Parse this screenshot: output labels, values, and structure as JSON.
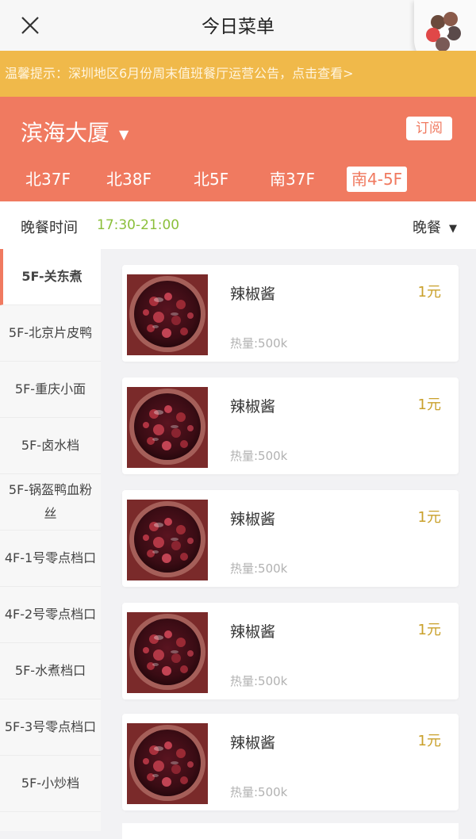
{
  "header": {
    "title": "今日菜单"
  },
  "notice": {
    "text": "温馨提示：深圳地区6月份周末值班餐厅运营公告，点击查看>"
  },
  "building": {
    "name": "滨海大厦",
    "subscribe_label": "订阅"
  },
  "floor_tabs": [
    {
      "label": "北37F"
    },
    {
      "label": "北38F"
    },
    {
      "label": "北5F"
    },
    {
      "label": "南37F"
    },
    {
      "label": "南4-5F",
      "active": true
    }
  ],
  "meal": {
    "label": "晚餐时间",
    "time": "17:30-21:00",
    "selected": "晚餐"
  },
  "sidebar": {
    "items": [
      {
        "label": "5F-关东煮",
        "active": true
      },
      {
        "label": "5F-北京片皮鸭"
      },
      {
        "label": "5F-重庆小面"
      },
      {
        "label": "5F-卤水档"
      },
      {
        "label": "5F-锅盔鸭血粉丝"
      },
      {
        "label": "4F-1号零点档口"
      },
      {
        "label": "4F-2号零点档口"
      },
      {
        "label": "5F-水煮档口"
      },
      {
        "label": "5F-3号零点档口"
      },
      {
        "label": "5F-小炒档"
      }
    ]
  },
  "dishes": [
    {
      "name": "辣椒酱",
      "price": "1元",
      "calories": "热量:500k"
    },
    {
      "name": "辣椒酱",
      "price": "1元",
      "calories": "热量:500k"
    },
    {
      "name": "辣椒酱",
      "price": "1元",
      "calories": "热量:500k"
    },
    {
      "name": "辣椒酱",
      "price": "1元",
      "calories": "热量:500k"
    },
    {
      "name": "辣椒酱",
      "price": "1元",
      "calories": "热量:500k"
    }
  ],
  "colors": {
    "accent": "#f07a60",
    "notice_bg": "#f0b94a",
    "time_green": "#8bbf3a",
    "price_gold": "#c9a02a"
  },
  "icons": {
    "close": "close-icon",
    "dropdown": "chevron-down-icon",
    "logo": "app-logo-icon"
  }
}
